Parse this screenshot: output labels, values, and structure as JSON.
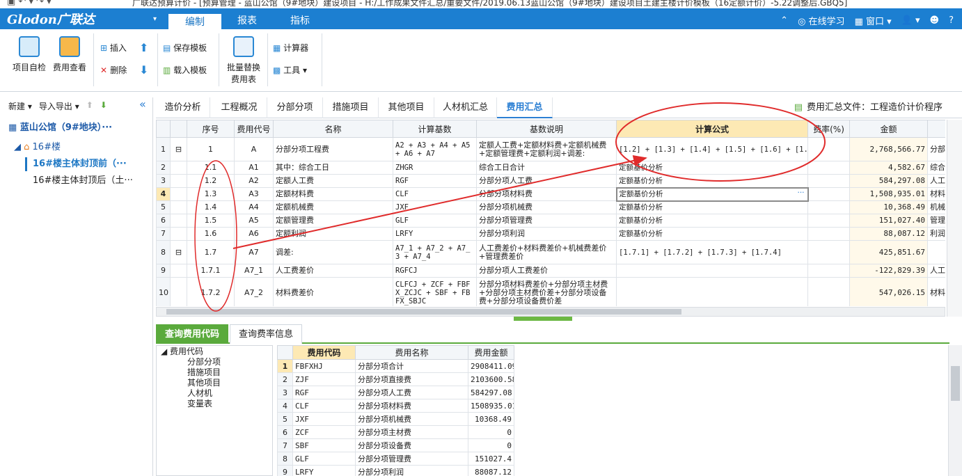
{
  "titlebar": {
    "quick_access": "▣ ↶ ▾ ↷ ▾",
    "title": "广联达预算计价 - [预算管理 - 蓝山公馆（9#地块）建设项目 - H:/工作成果文件汇总/重要文件/2019.06.13蓝山公馆（9#地块）建设项目土建主楼计价模板（16定额计价）-5.22调整后.GBQ5]"
  },
  "menubar": {
    "brand_logo": "Glodon广联达",
    "brand_arrow": "▾",
    "tabs": [
      "编制",
      "报表",
      "指标"
    ],
    "online_learning": "在线学习",
    "window_menu": "窗口",
    "help": "?"
  },
  "ribbon": {
    "self_check": "项目自检",
    "fee_view": "费用查看",
    "insert": "插入",
    "delete": "删除",
    "save_template": "保存模板",
    "load_template": "载入模板",
    "batch_replace_line1": "批量替换",
    "batch_replace_line2": "费用表",
    "calculator": "计算器",
    "tools": "工具"
  },
  "left_panel": {
    "new": "新建",
    "import_export": "导入导出",
    "project": "蓝山公馆（9#地块）···",
    "building": "16#楼",
    "unit_1": "16#楼主体封顶前（···",
    "unit_2": "16#楼主体封顶后（土···"
  },
  "tabs": [
    "造价分析",
    "工程概况",
    "分部分项",
    "措施项目",
    "其他项目",
    "人材机汇总",
    "费用汇总"
  ],
  "tabs_active_index": 6,
  "summary_file_label": "费用汇总文件：工程造价计价程序",
  "grid": {
    "headers": [
      "序号",
      "费用代号",
      "名称",
      "计算基数",
      "基数说明",
      "计算公式",
      "费率(%)",
      "金额",
      ""
    ],
    "rows": [
      {
        "rn": "1",
        "tree": "⊟",
        "seq": "1",
        "code": "A",
        "name": "分部分项工程费",
        "base": "A2 + A3 + A4 + A5 + A6 + A7",
        "desc": "定额人工费+定额材料费+定额机械费+定额管理费+定额利润+调差:",
        "formula": "[1.2] + [1.3] + [1.4] + [1.5] + [1.6] + [1.7]",
        "rate": "",
        "amount": "2,768,566.77",
        "extra": "分部分"
      },
      {
        "rn": "2",
        "tree": "",
        "seq": "1.1",
        "code": "A1",
        "name": "其中：综合工日",
        "base": "ZHGR",
        "desc": "综合工日合计",
        "formula": "定额基价分析",
        "rate": "",
        "amount": "4,582.67",
        "extra": "综合工"
      },
      {
        "rn": "3",
        "tree": "",
        "seq": "1.2",
        "code": "A2",
        "name": "定额人工费",
        "base": "RGF",
        "desc": "分部分项人工费",
        "formula": "定额基价分析",
        "rate": "",
        "amount": "584,297.08",
        "extra": "人工费"
      },
      {
        "rn": "4",
        "tree": "",
        "seq": "1.3",
        "code": "A3",
        "name": "定额材料费",
        "base": "CLF",
        "desc": "分部分项材料费",
        "formula": "定额基价分析",
        "rate": "",
        "amount": "1,508,935.01",
        "extra": "材料费"
      },
      {
        "rn": "5",
        "tree": "",
        "seq": "1.4",
        "code": "A4",
        "name": "定额机械费",
        "base": "JXF",
        "desc": "分部分项机械费",
        "formula": "定额基价分析",
        "rate": "",
        "amount": "10,368.49",
        "extra": "机械费"
      },
      {
        "rn": "6",
        "tree": "",
        "seq": "1.5",
        "code": "A5",
        "name": "定额管理费",
        "base": "GLF",
        "desc": "分部分项管理费",
        "formula": "定额基价分析",
        "rate": "",
        "amount": "151,027.40",
        "extra": "管理费"
      },
      {
        "rn": "7",
        "tree": "",
        "seq": "1.6",
        "code": "A6",
        "name": "定额利润",
        "base": "LRFY",
        "desc": "分部分项利润",
        "formula": "定额基价分析",
        "rate": "",
        "amount": "88,087.12",
        "extra": "利润"
      },
      {
        "rn": "8",
        "tree": "⊟",
        "seq": "1.7",
        "code": "A7",
        "name": "调差:",
        "base": "A7_1 + A7_2 + A7_3 + A7_4",
        "desc": "人工费差价+材料费差价+机械费差价+管理费差价",
        "formula": "[1.7.1] + [1.7.2] + [1.7.3] + [1.7.4]",
        "rate": "",
        "amount": "425,851.67",
        "extra": ""
      },
      {
        "rn": "9",
        "tree": "",
        "seq": "1.7.1",
        "code": "A7_1",
        "name": "人工费差价",
        "base": "RGFCJ",
        "desc": "分部分项人工费差价",
        "formula": "",
        "rate": "",
        "amount": "-122,829.39",
        "extra": "人工费"
      },
      {
        "rn": "10",
        "tree": "",
        "seq": "1.7.2",
        "code": "A7_2",
        "name": "材料费差价",
        "base": "CLFCJ + ZCF + FBFX_ZCJC + SBF + FBFX_SBJC",
        "desc": "分部分项材料费差价+分部分项主材费+分部分项主材费价差+分部分项设备费+分部分项设备费价差",
        "formula": "",
        "rate": "",
        "amount": "547,026.15",
        "extra": "材料费"
      }
    ],
    "selected_row_index": 3,
    "selected_cell_ellipsis": "···"
  },
  "bottom_tabs": [
    "查询费用代码",
    "查询费率信息"
  ],
  "bottom_tree": {
    "root": "费用代码",
    "children": [
      "分部分项",
      "措施项目",
      "其他项目",
      "人材机",
      "变量表"
    ]
  },
  "bottom_grid": {
    "headers": [
      "",
      "费用代码",
      "费用名称",
      "费用金额"
    ],
    "rows": [
      {
        "rn": "1",
        "code": "FBFXHJ",
        "name": "分部分项合计",
        "amount": "2908411.09"
      },
      {
        "rn": "2",
        "code": "ZJF",
        "name": "分部分项直接费",
        "amount": "2103600.58"
      },
      {
        "rn": "3",
        "code": "RGF",
        "name": "分部分项人工费",
        "amount": "584297.08"
      },
      {
        "rn": "4",
        "code": "CLF",
        "name": "分部分项材料费",
        "amount": "1508935.01"
      },
      {
        "rn": "5",
        "code": "JXF",
        "name": "分部分项机械费",
        "amount": "10368.49"
      },
      {
        "rn": "6",
        "code": "ZCF",
        "name": "分部分项主材费",
        "amount": "0"
      },
      {
        "rn": "7",
        "code": "SBF",
        "name": "分部分项设备费",
        "amount": "0"
      },
      {
        "rn": "8",
        "code": "GLF",
        "name": "分部分项管理费",
        "amount": "151027.4"
      },
      {
        "rn": "9",
        "code": "LRFY",
        "name": "分部分项利润",
        "amount": "88087.12"
      }
    ]
  },
  "colors": {
    "menubar_blue": "#1c7fd1",
    "active_tab_blue": "#2b7fd3",
    "highlight_header": "#fde9b4",
    "bottom_tab_green": "#5aaa3c",
    "annotation_red": "#e02b2b"
  }
}
